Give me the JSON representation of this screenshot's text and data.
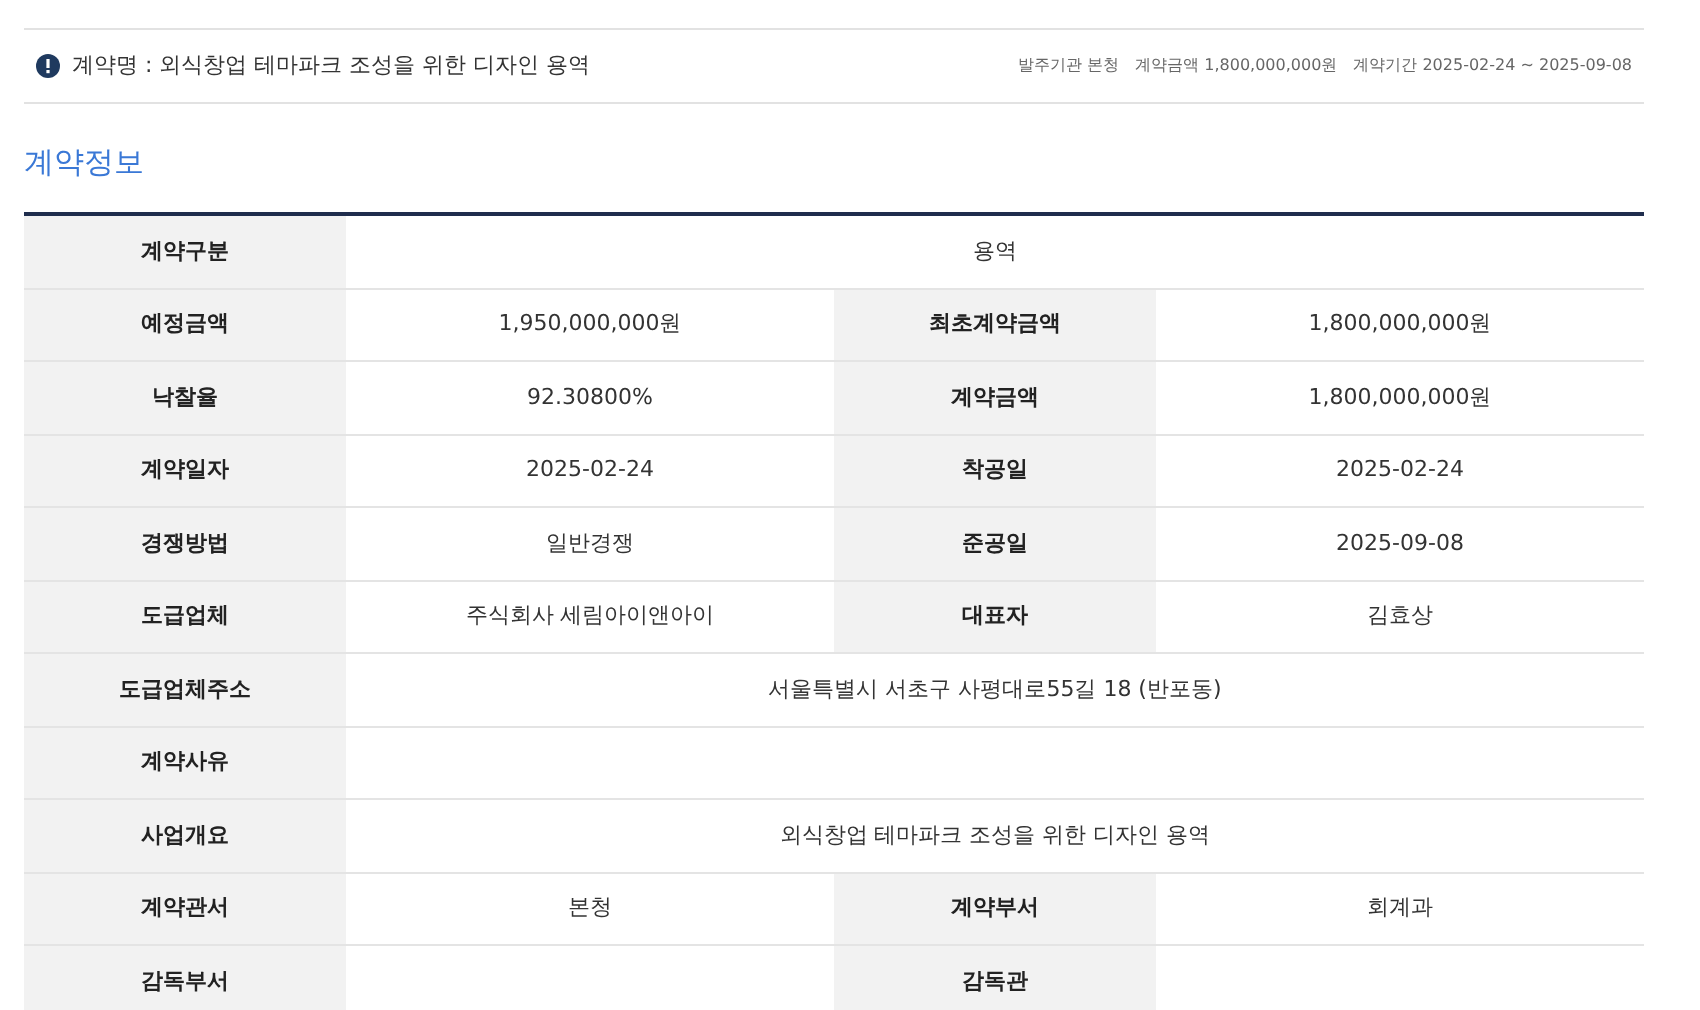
{
  "contract_header": {
    "title": "계약명 : 외식창업 테마파크 조성을 위한 디자인 용역",
    "meta": [
      {
        "label": "발주기관",
        "value": "본청"
      },
      {
        "label": "계약금액",
        "value": "1,800,000,000원"
      },
      {
        "label": "계약기간",
        "value": "2025-02-24 ~ 2025-09-08"
      }
    ]
  },
  "section_title": "계약정보",
  "table": {
    "rows": [
      {
        "cells": [
          {
            "label": "계약구분",
            "value": "용역"
          }
        ]
      },
      {
        "cells": [
          {
            "label": "예정금액",
            "value": "1,950,000,000원"
          },
          {
            "label": "최초계약금액",
            "value": "1,800,000,000원"
          }
        ]
      },
      {
        "cells": [
          {
            "label": "낙찰율",
            "value": "92.30800%"
          },
          {
            "label": "계약금액",
            "value": "1,800,000,000원"
          }
        ]
      },
      {
        "cells": [
          {
            "label": "계약일자",
            "value": "2025-02-24"
          },
          {
            "label": "착공일",
            "value": "2025-02-24"
          }
        ]
      },
      {
        "cells": [
          {
            "label": "경쟁방법",
            "value": "일반경쟁"
          },
          {
            "label": "준공일",
            "value": "2025-09-08"
          }
        ]
      },
      {
        "cells": [
          {
            "label": "도급업체",
            "value": "주식회사 세림아이앤아이"
          },
          {
            "label": "대표자",
            "value": "김효상"
          }
        ]
      },
      {
        "cells": [
          {
            "label": "도급업체주소",
            "value": "서울특별시 서초구 사평대로55길 18 (반포동)"
          }
        ]
      },
      {
        "cells": [
          {
            "label": "계약사유"
          }
        ]
      },
      {
        "cells": [
          {
            "label": "사업개요",
            "value": "외식창업 테마파크 조성을 위한 디자인 용역"
          }
        ]
      },
      {
        "cells": [
          {
            "label": "계약관서",
            "value": "본청"
          },
          {
            "label": "계약부서",
            "value": "회계과"
          }
        ]
      },
      {
        "cells": [
          {
            "label": "감독부서"
          },
          {
            "label": "감독관"
          }
        ]
      }
    ]
  }
}
